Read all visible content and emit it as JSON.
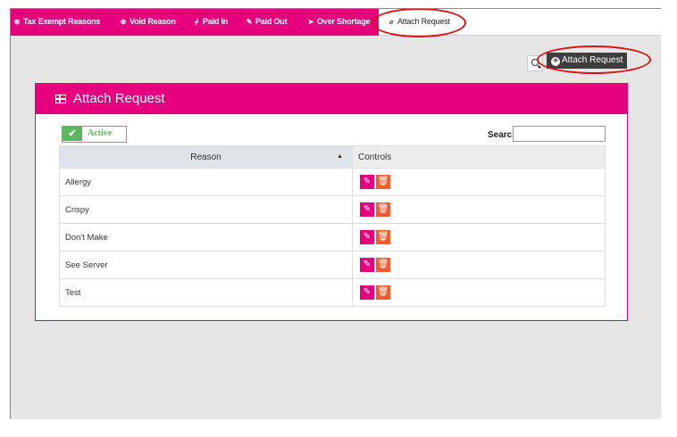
{
  "tabs": [
    {
      "icon": "circle-x-icon",
      "glyph": "⊗",
      "label": "Tax Exempt Reasons",
      "active": false
    },
    {
      "icon": "circle-x-icon",
      "glyph": "⊗",
      "label": "Void Reason",
      "active": false
    },
    {
      "icon": "pin-icon",
      "glyph": "ᚋ",
      "label": "Paid In",
      "active": false
    },
    {
      "icon": "pencil-icon",
      "glyph": "✎",
      "label": "Paid Out",
      "active": false
    },
    {
      "icon": "arrow-right-icon",
      "glyph": "➤",
      "label": "Over Shortage",
      "active": false
    },
    {
      "icon": "paperclip-icon",
      "glyph": "⌀",
      "label": "Attach Request",
      "active": true
    }
  ],
  "toolbar": {
    "add_button_label": "Attach Request",
    "plus_glyph": "+"
  },
  "panel": {
    "title": "Attach Request",
    "status_toggle_label": "Active",
    "check_glyph": "✔",
    "search_label": "Search",
    "search_value": ""
  },
  "table": {
    "columns": [
      "Reason",
      "Controls"
    ],
    "sort_glyph": "▲",
    "rows": [
      {
        "reason": "Allergy"
      },
      {
        "reason": "Crispy"
      },
      {
        "reason": "Don't Make"
      },
      {
        "reason": "See Server"
      },
      {
        "reason": "Test"
      }
    ]
  },
  "icons": {
    "edit_glyph": "✎",
    "delete_glyph": "🗑"
  },
  "colors": {
    "brand_pink": "#e6007e",
    "delete_orange": "#f25c2e",
    "active_green": "#5cb85c",
    "toolbar_dark": "#3d3d3d",
    "annotation_red": "#dd1111"
  }
}
